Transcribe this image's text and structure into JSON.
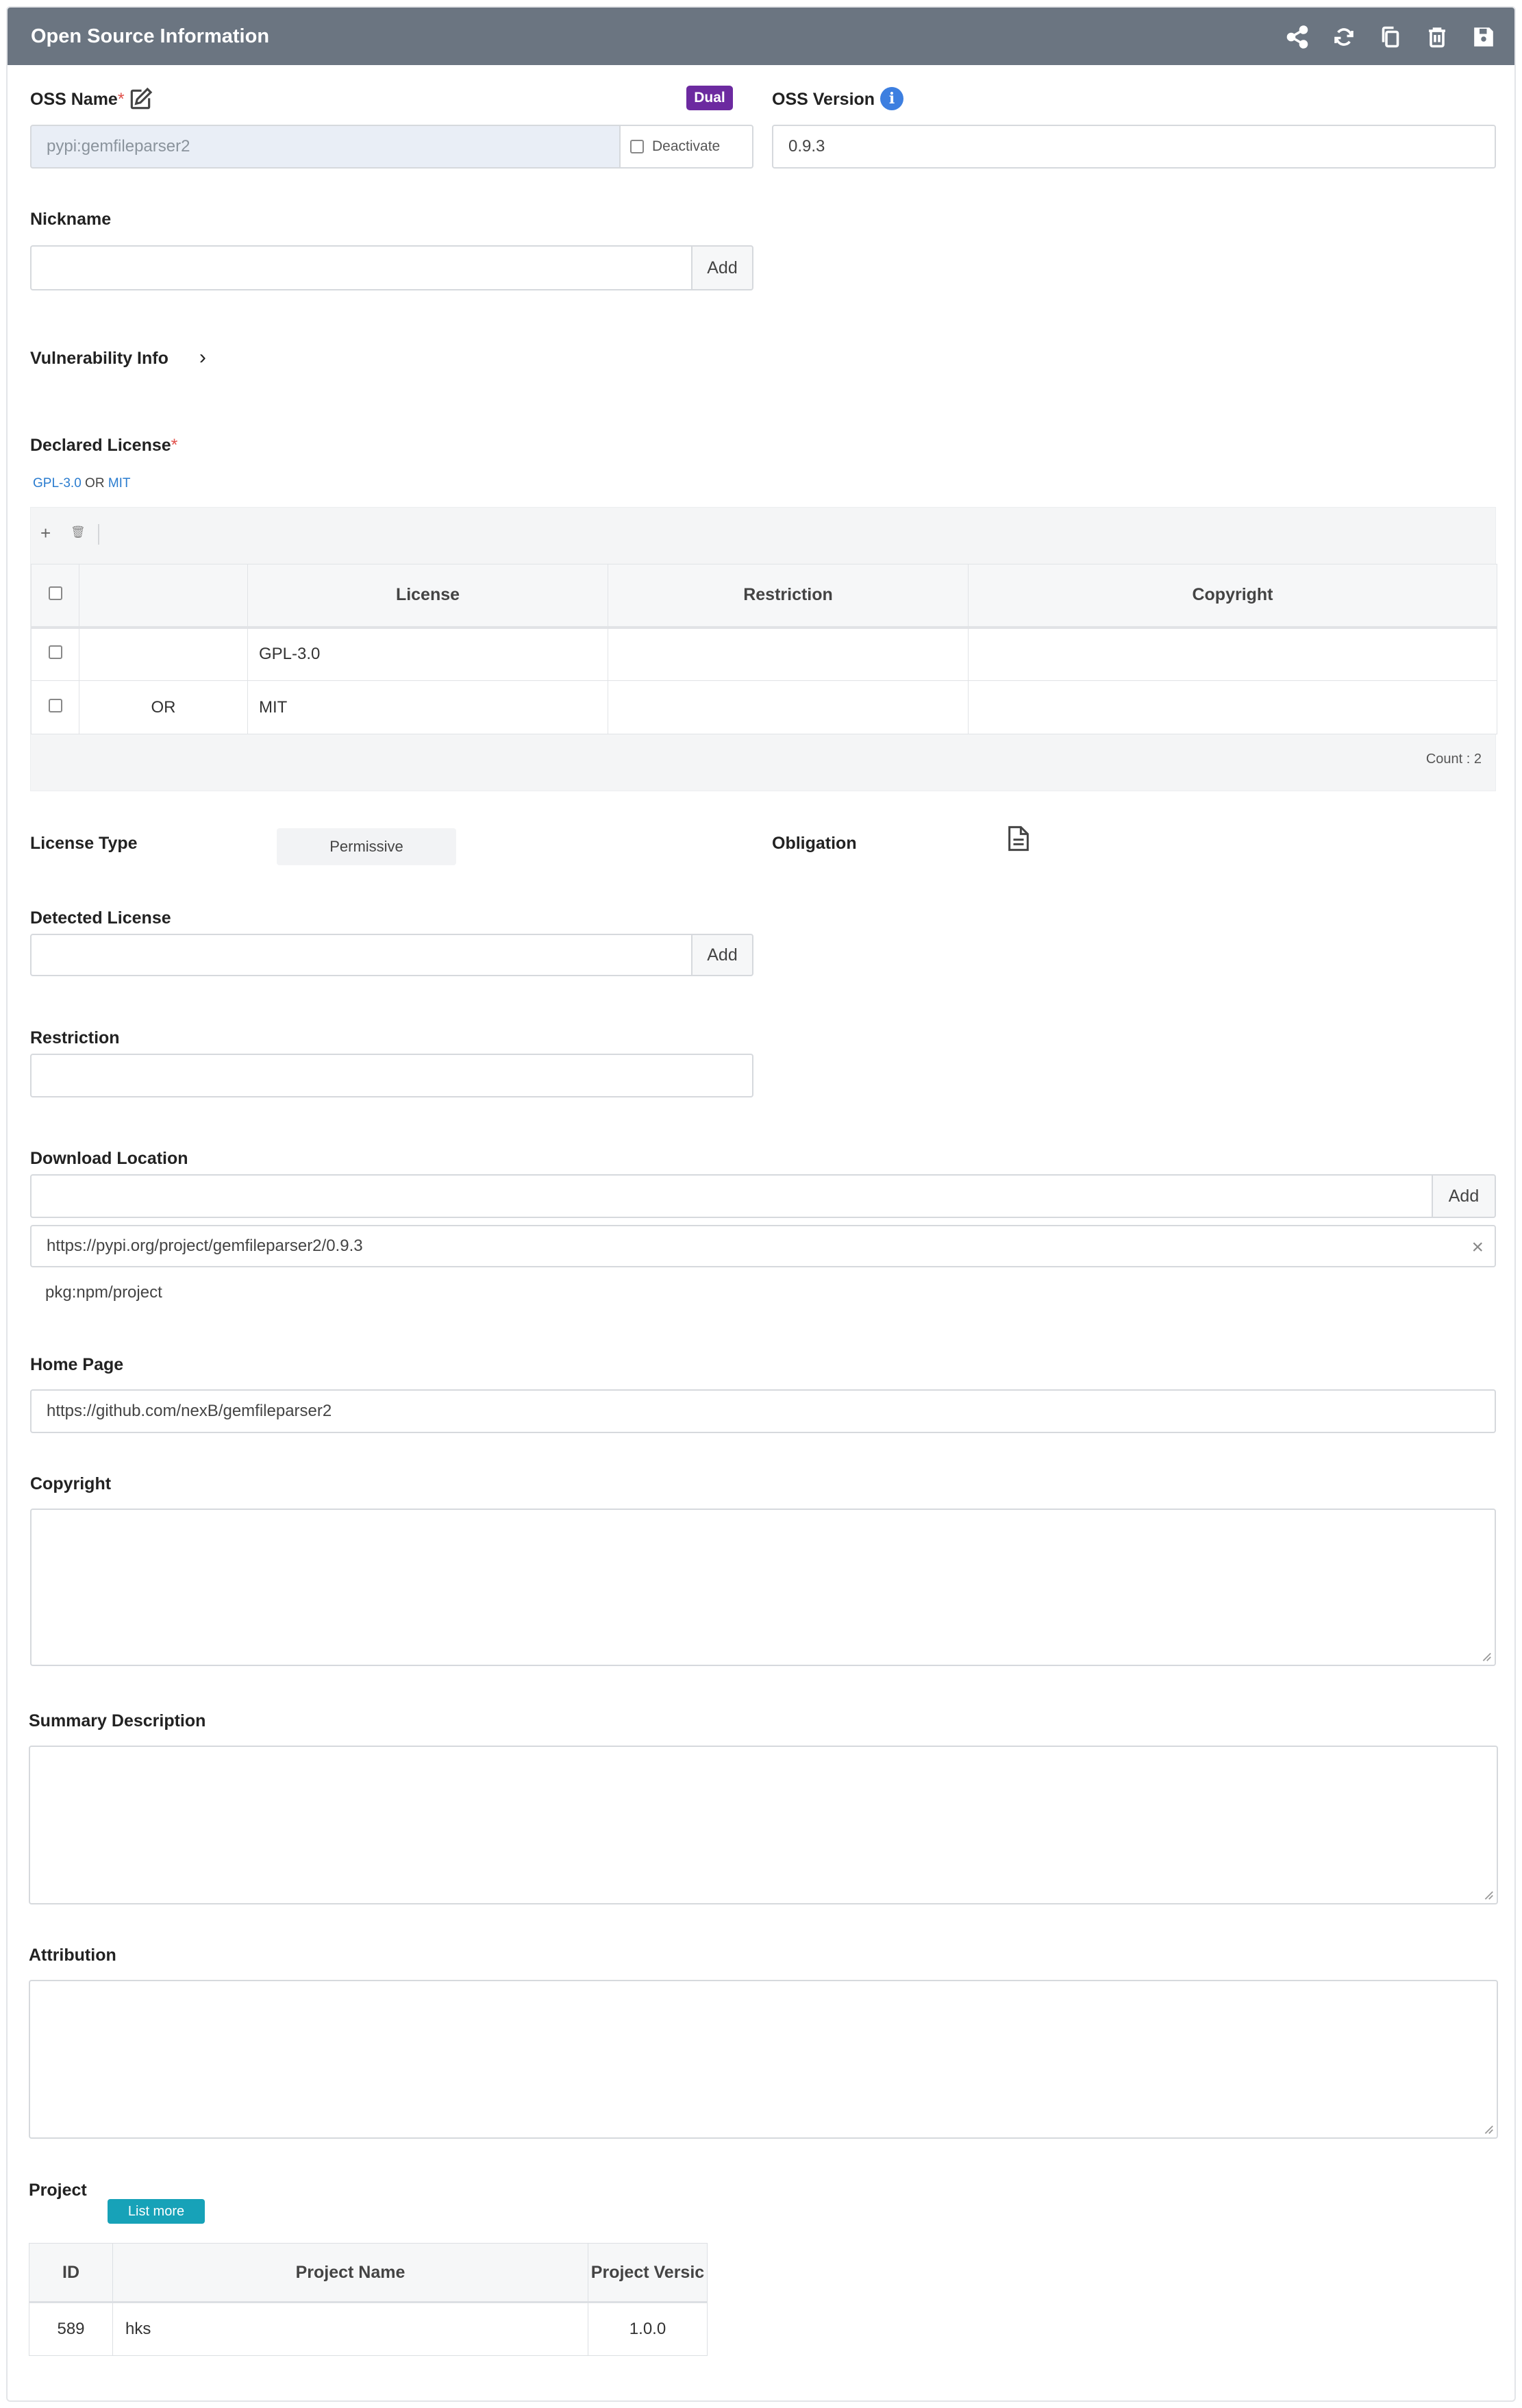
{
  "header": {
    "title": "Open Source Information",
    "icons": [
      "share-icon",
      "refresh-icon",
      "copy-icon",
      "trash-icon",
      "save-icon"
    ]
  },
  "oss_name": {
    "label": "OSS Name",
    "required_mark": "*",
    "value": "pypi:gemfileparser2",
    "deactivate_label": "Deactivate",
    "badge": "Dual"
  },
  "oss_version": {
    "label": "OSS Version",
    "value": "0.9.3"
  },
  "nickname": {
    "label": "Nickname",
    "value": "",
    "add_label": "Add"
  },
  "vulnerability": {
    "label": "Vulnerability Info",
    "chevron": "›"
  },
  "declared_license": {
    "label": "Declared License",
    "required_mark": "*",
    "summary_left": "GPL-3.0",
    "summary_op": "OR",
    "summary_right": "MIT",
    "toolbar": {
      "add": "+",
      "delete": "🗑"
    },
    "columns": [
      "",
      "",
      "License",
      "Restriction",
      "Copyright"
    ],
    "rows": [
      {
        "op": "",
        "license": "GPL-3.0",
        "restriction": "",
        "copyright": ""
      },
      {
        "op": "OR",
        "license": "MIT",
        "restriction": "",
        "copyright": ""
      }
    ],
    "count": "Count : 2"
  },
  "license_type": {
    "label": "License Type",
    "value": "Permissive"
  },
  "obligation": {
    "label": "Obligation"
  },
  "detected_license": {
    "label": "Detected License",
    "value": "",
    "add_label": "Add"
  },
  "restriction": {
    "label": "Restriction",
    "value": ""
  },
  "download_location": {
    "label": "Download Location",
    "value": "",
    "add_label": "Add",
    "entries": [
      "https://pypi.org/project/gemfileparser2/0.9.3"
    ],
    "clear": "×",
    "purl": "pkg:npm/project"
  },
  "home_page": {
    "label": "Home Page",
    "value": "https://github.com/nexB/gemfileparser2"
  },
  "copyright": {
    "label": "Copyright"
  },
  "summary_description": {
    "label": "Summary Description"
  },
  "attribution": {
    "label": "Attribution"
  },
  "project": {
    "label": "Project",
    "list_more": "List more",
    "columns": [
      "ID",
      "Project Name",
      "Project Versic"
    ],
    "rows": [
      {
        "id": "589",
        "name": "hks",
        "version": "1.0.0"
      }
    ]
  }
}
